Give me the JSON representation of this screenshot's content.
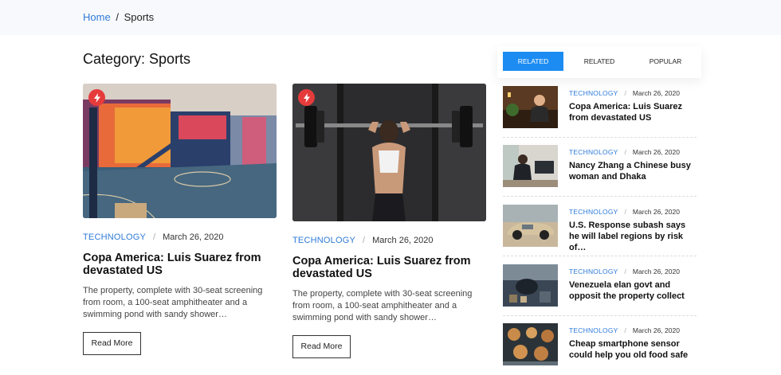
{
  "breadcrumb": {
    "home": "Home",
    "separator": "/",
    "current": "Sports"
  },
  "category_title": "Category: Sports",
  "posts": [
    {
      "category": "TECHNOLOGY",
      "date": "March 26, 2020",
      "title": "Copa America: Luis Suarez from devastated US",
      "excerpt": "The property, complete with 30-seat screening from room, a 100-seat amphitheater and a swimming pond with sandy shower…",
      "button": "Read More",
      "image_icon": "flash-icon"
    },
    {
      "category": "TECHNOLOGY",
      "date": "March 26, 2020",
      "title": "Copa America: Luis Suarez from devastated US",
      "excerpt": "The property, complete with 30-seat screening from room, a 100-seat amphitheater and a swimming pond with sandy shower…",
      "button": "Read More",
      "image_icon": "flash-icon"
    }
  ],
  "tabs": [
    {
      "label": "RELATED",
      "active": true
    },
    {
      "label": "RELATED",
      "active": false
    },
    {
      "label": "POPULAR",
      "active": false
    }
  ],
  "sidebar": [
    {
      "category": "TECHNOLOGY",
      "date": "March 26, 2020",
      "title": "Copa America: Luis Suarez from devastated US"
    },
    {
      "category": "TECHNOLOGY",
      "date": "March 26, 2020",
      "title": "Nancy Zhang a Chinese busy woman and Dhaka"
    },
    {
      "category": "TECHNOLOGY",
      "date": "March 26, 2020",
      "title": "U.S. Response subash says he will label regions by risk of…"
    },
    {
      "category": "TECHNOLOGY",
      "date": "March 26, 2020",
      "title": "Venezuela elan govt and opposit the property collect"
    },
    {
      "category": "TECHNOLOGY",
      "date": "March 26, 2020",
      "title": "Cheap smartphone sensor could help you old food safe"
    }
  ],
  "colors": {
    "accent": "#2f7bd8",
    "tab_active": "#1c8cf2",
    "badge": "#e63b3b"
  }
}
